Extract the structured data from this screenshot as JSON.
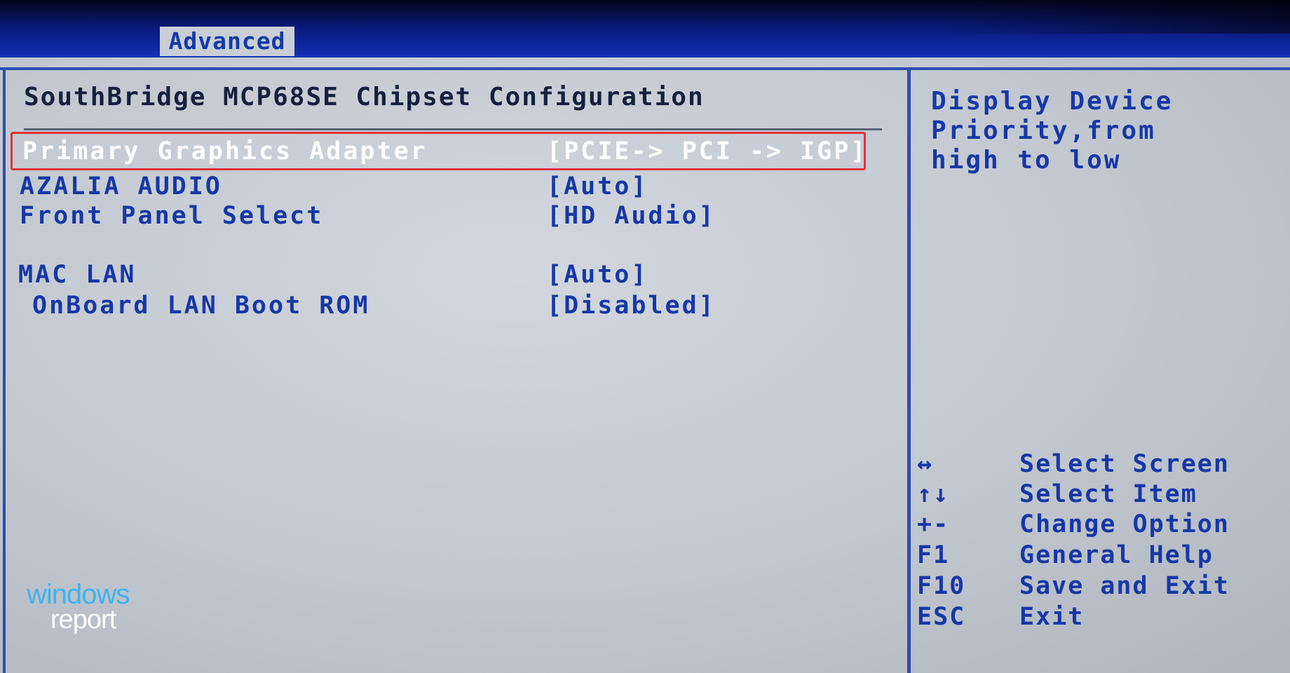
{
  "menu": {
    "active_tab": "Advanced"
  },
  "section": {
    "title": "SouthBridge MCP68SE Chipset Configuration"
  },
  "settings": [
    {
      "label": "Primary Graphics Adapter",
      "value": "[PCIE-> PCI -> IGP]",
      "selected": true
    },
    {
      "label": "AZALIA AUDIO",
      "value": "[Auto]",
      "selected": false
    },
    {
      "label": "Front Panel Select",
      "value": "[HD Audio]",
      "selected": false
    },
    {
      "label": "MAC LAN",
      "value": "[Auto]",
      "selected": false
    },
    {
      "label": "OnBoard LAN Boot ROM",
      "value": "[Disabled]",
      "selected": false
    }
  ],
  "help": {
    "text": "Display Device\nPriority,from\nhigh to low"
  },
  "keys": [
    {
      "key": "↔",
      "icon": "left-right-arrow-icon",
      "action": "Select Screen"
    },
    {
      "key": "↑↓",
      "icon": "up-down-arrow-icon",
      "action": "Select Item"
    },
    {
      "key": "+-",
      "icon": "plus-minus-icon",
      "action": "Change Option"
    },
    {
      "key": "F1",
      "action": "General Help"
    },
    {
      "key": "F10",
      "action": "Save and Exit"
    },
    {
      "key": "ESC",
      "action": "Exit"
    }
  ],
  "watermark": {
    "line1": "windows",
    "line2": "report"
  },
  "colors": {
    "text_blue": "#1737a6",
    "highlight_red": "#e0323a",
    "background": "#c2c8d0",
    "header_blue": "#1030b8"
  }
}
